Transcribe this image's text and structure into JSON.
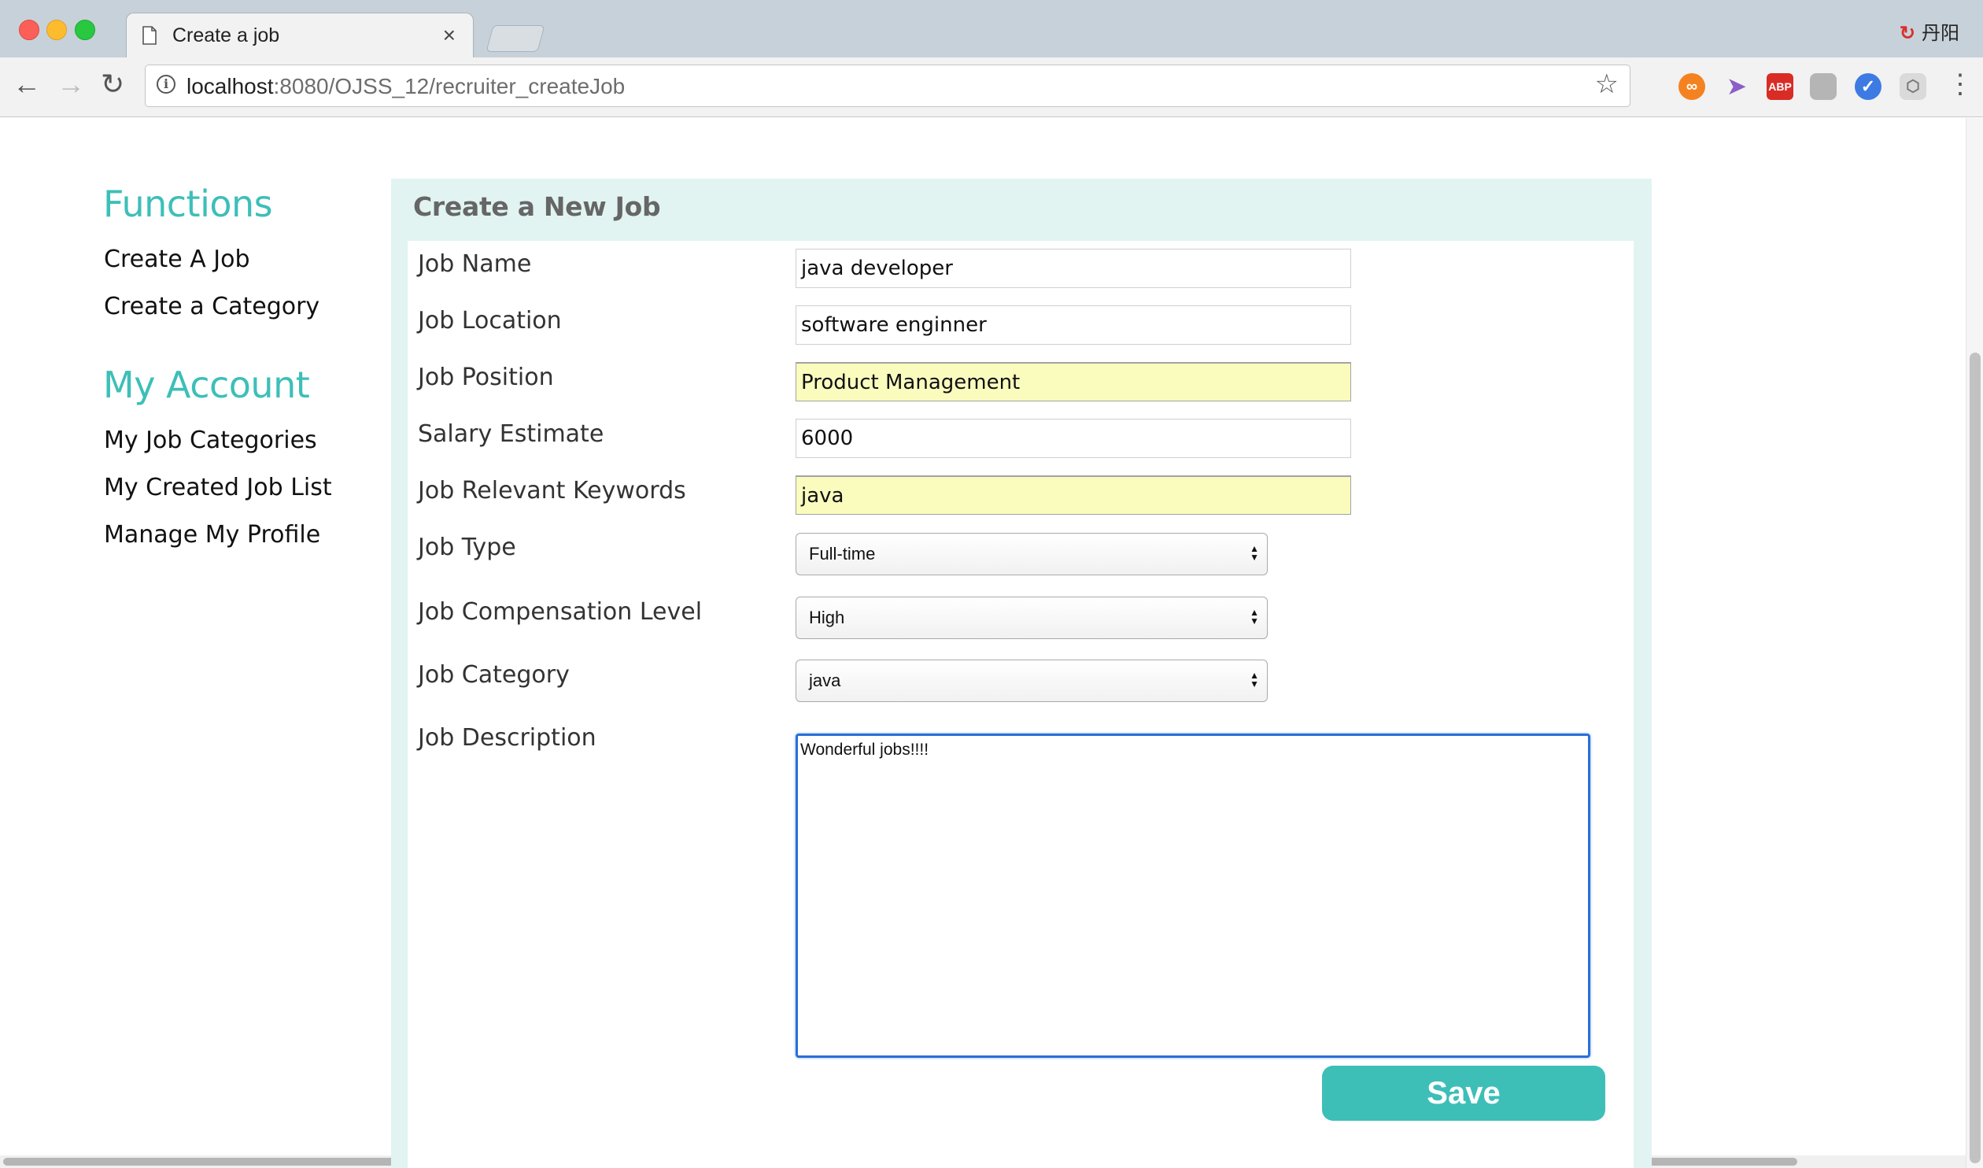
{
  "browser": {
    "tab_title": "Create a job",
    "tab_close": "×",
    "profile_name": "丹阳",
    "url_host": "localhost",
    "url_rest": ":8080/OJSS_12/recruiter_createJob",
    "extensions": [
      "∞",
      "➤",
      "ABP",
      "",
      "✓",
      "⬡"
    ]
  },
  "sidebar": {
    "functions_heading": "Functions",
    "functions_items": [
      "Create A Job",
      "Create a Category"
    ],
    "account_heading": "My Account",
    "account_items": [
      "My Job Categories",
      "My Created Job List",
      "Manage My Profile"
    ]
  },
  "form": {
    "title": "Create a New Job",
    "fields": [
      {
        "label": "Job Name",
        "value": "java developer"
      },
      {
        "label": "Job Location",
        "value": "software enginner"
      },
      {
        "label": "Job Position",
        "value": "Product Management"
      },
      {
        "label": "Salary Estimate",
        "value": "6000"
      },
      {
        "label": "Job Relevant Keywords",
        "value": "java"
      }
    ],
    "selects": [
      {
        "label": "Job Type",
        "value": "Full-time"
      },
      {
        "label": "Job Compensation Level",
        "value": "High"
      },
      {
        "label": "Job Category",
        "value": "java"
      }
    ],
    "description_label": "Job Description",
    "description_value": "Wonderful jobs!!!!",
    "save_label": "Save"
  },
  "colors": {
    "accent": "#3dbfb8",
    "panel_bg": "#e1f4f2",
    "autofill": "#fafcbe"
  }
}
